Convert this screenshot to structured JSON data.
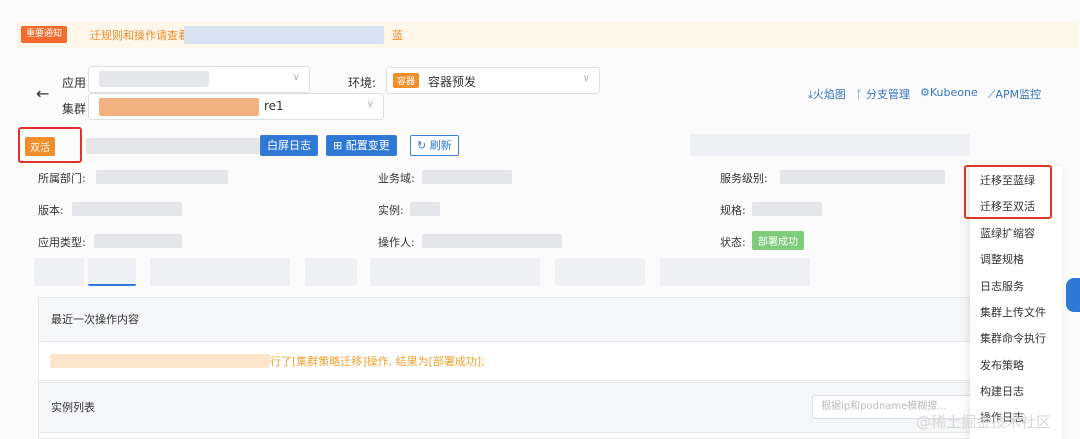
{
  "notice": {
    "badge": "重要通知",
    "text": "迁规则和操作请查看",
    "tail": "蓝"
  },
  "header": {
    "app_label": "应用",
    "cluster_label": "集群",
    "cluster_value_suffix": "re1",
    "env_label": "环境:",
    "env_tag": "容器",
    "env_value": "容器预发"
  },
  "toplinks": [
    "火焰图",
    "分支管理",
    "Kubeone",
    "APM监控"
  ],
  "toolbar": {
    "live_tag": "双活",
    "log_button": "白屏日志",
    "config_button": "配置变更",
    "refresh_button": "刷新"
  },
  "info": {
    "dept": "所属部门:",
    "domain": "业务域:",
    "service_level": "服务级别:",
    "version": "版本:",
    "instance": "实例:",
    "spec": "规格:",
    "app_type": "应用类型:",
    "operator": "操作人:",
    "status": "状态:",
    "status_value": "部署成功"
  },
  "panels": {
    "last_op_title": "最近一次操作内容",
    "last_op_result": "行了[集群策略迁移]操作, 结果为[部署成功];",
    "instances_title": "实例列表",
    "search_placeholder": "根据ip和podname模糊搜..."
  },
  "menu": [
    "迁移至蓝绿",
    "迁移至双活",
    "蓝绿扩缩容",
    "调整规格",
    "日志服务",
    "集群上传文件",
    "集群命令执行",
    "发布策略",
    "构建日志",
    "操作日志"
  ],
  "watermark": "@稀土掘金技术社区",
  "colors": {
    "accent": "#2f78d6",
    "orange": "#f08e2c",
    "highlight": "#e0342a",
    "success": "#7fcc7a"
  }
}
